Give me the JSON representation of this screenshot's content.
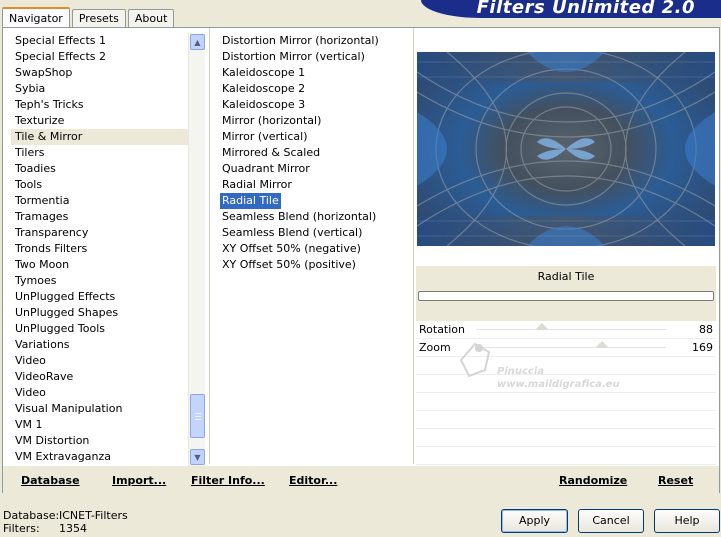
{
  "app_title": "Filters Unlimited 2.0",
  "tabs": [
    {
      "label": "Navigator"
    },
    {
      "label": "Presets"
    },
    {
      "label": "About"
    }
  ],
  "categories": [
    {
      "label": "Special Effects 1"
    },
    {
      "label": "Special Effects 2"
    },
    {
      "label": "SwapShop"
    },
    {
      "label": "Sybia"
    },
    {
      "label": "Teph's Tricks"
    },
    {
      "label": "Texturize"
    },
    {
      "label": "Tile & Mirror"
    },
    {
      "label": "Tilers"
    },
    {
      "label": "Toadies"
    },
    {
      "label": "Tools"
    },
    {
      "label": "Tormentia"
    },
    {
      "label": "Tramages"
    },
    {
      "label": "Transparency"
    },
    {
      "label": "Tronds Filters"
    },
    {
      "label": "Two Moon"
    },
    {
      "label": "Tymoes"
    },
    {
      "label": "UnPlugged Effects"
    },
    {
      "label": "UnPlugged Shapes"
    },
    {
      "label": "UnPlugged Tools"
    },
    {
      "label": "Variations"
    },
    {
      "label": "Video"
    },
    {
      "label": "VideoRave"
    },
    {
      "label": "Video"
    },
    {
      "label": "Visual Manipulation"
    },
    {
      "label": "VM 1"
    },
    {
      "label": "VM Distortion"
    },
    {
      "label": "VM Extravaganza"
    }
  ],
  "selected_category": "Tile & Mirror",
  "filters": [
    {
      "label": "Distortion Mirror (horizontal)"
    },
    {
      "label": "Distortion Mirror (vertical)"
    },
    {
      "label": "Kaleidoscope 1"
    },
    {
      "label": "Kaleidoscope 2"
    },
    {
      "label": "Kaleidoscope 3"
    },
    {
      "label": "Mirror (horizontal)"
    },
    {
      "label": "Mirror (vertical)"
    },
    {
      "label": "Mirrored & Scaled"
    },
    {
      "label": "Quadrant Mirror"
    },
    {
      "label": "Radial Mirror"
    },
    {
      "label": "Radial Tile"
    },
    {
      "label": "Seamless Blend (horizontal)"
    },
    {
      "label": "Seamless Blend (vertical)"
    },
    {
      "label": "XY Offset 50% (negative)"
    },
    {
      "label": "XY Offset 50% (positive)"
    }
  ],
  "selected_filter": "Radial Tile",
  "current_filter_name": "Radial Tile",
  "params": [
    {
      "label": "Rotation",
      "value": "88",
      "fraction": 0.345
    },
    {
      "label": "Zoom",
      "value": "169",
      "fraction": 0.663
    }
  ],
  "watermark": {
    "line1": "Pinuccia",
    "line2": "www.maildigrafica.eu"
  },
  "bottom_links": {
    "database": "Database",
    "import": "Import...",
    "filter_info": "Filter Info...",
    "editor": "Editor...",
    "randomize": "Randomize",
    "reset": "Reset"
  },
  "status": {
    "database_label": "Database:",
    "database_value": "ICNET-Filters",
    "filters_label": "Filters:",
    "filters_value": "1354"
  },
  "buttons": {
    "apply": "Apply",
    "cancel": "Cancel",
    "help": "Help"
  },
  "colors": {
    "selection": "#316ac5",
    "banner": "#1a2d8a",
    "tab_accent": "#e68b2c",
    "window_bg": "#ece9d8"
  }
}
